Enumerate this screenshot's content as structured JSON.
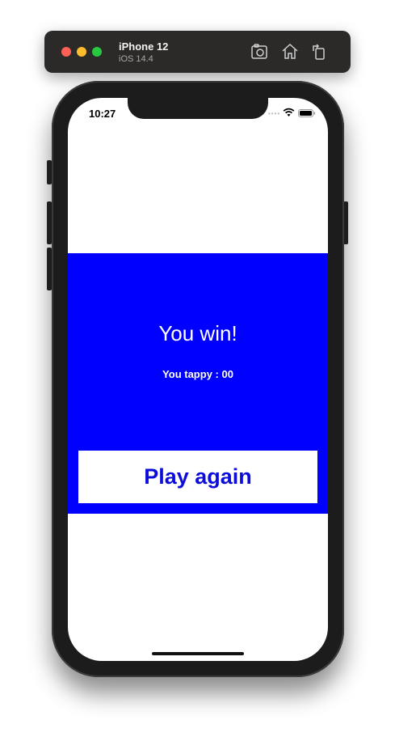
{
  "window": {
    "device_name": "iPhone 12",
    "os_version": "iOS 14.4",
    "controls": {
      "close_color": "#fe5f57",
      "minimize_color": "#febc2e",
      "maximize_color": "#28c840"
    },
    "toolbar_icons": [
      "camera-screenshot-icon",
      "home-icon",
      "rotate-icon"
    ]
  },
  "status_bar": {
    "time": "10:27",
    "signal_dots": "••••",
    "icons": [
      "wifi-icon",
      "battery-icon"
    ]
  },
  "game": {
    "result_title": "You win!",
    "score_text": "You tappy : 00",
    "play_again_label": "Play again",
    "panel_color": "#0000ff",
    "button_text_color": "#0d0ddb"
  }
}
